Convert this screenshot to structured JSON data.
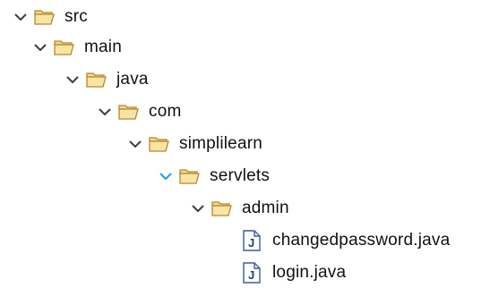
{
  "colors": {
    "chevron_default": "#3c3c3c",
    "chevron_active": "#1e9be6",
    "folder_fill": "#f3d88a",
    "folder_stroke": "#b8862b",
    "file_stroke": "#3b5b9e",
    "file_letter": "#1c3f86"
  },
  "tree": {
    "items": [
      {
        "label": "src",
        "icon": "folder-icon",
        "expanded": true
      },
      {
        "label": "main",
        "icon": "folder-icon",
        "expanded": true
      },
      {
        "label": "java",
        "icon": "folder-icon",
        "expanded": true
      },
      {
        "label": "com",
        "icon": "folder-icon",
        "expanded": true
      },
      {
        "label": "simplilearn",
        "icon": "folder-icon",
        "expanded": true
      },
      {
        "label": "servlets",
        "icon": "folder-icon",
        "expanded": true,
        "chevron_highlight": true
      },
      {
        "label": "admin",
        "icon": "folder-icon",
        "expanded": true
      },
      {
        "label": "changedpassword.java",
        "icon": "java-file-icon"
      },
      {
        "label": "login.java",
        "icon": "java-file-icon"
      }
    ]
  }
}
